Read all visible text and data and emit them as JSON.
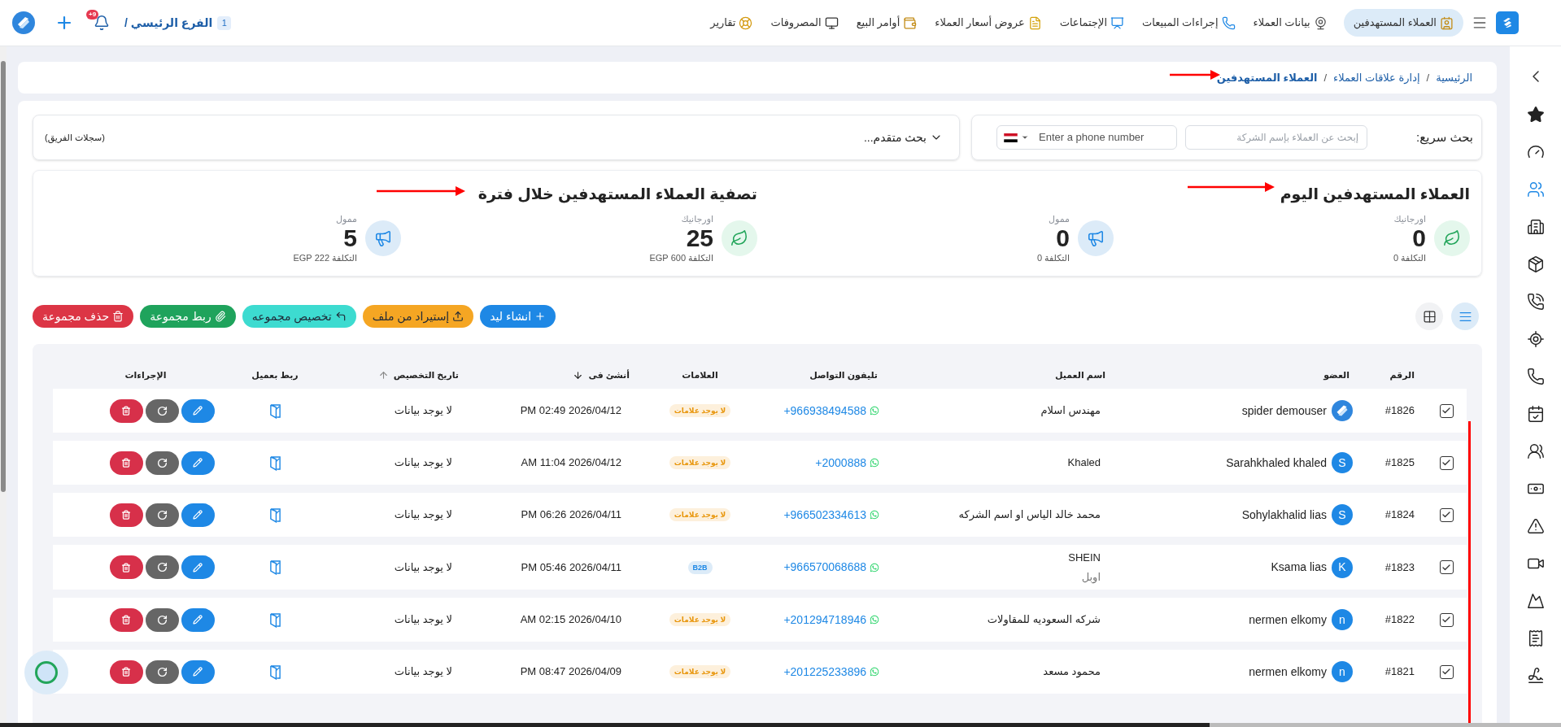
{
  "topbar": {
    "tabs": [
      {
        "label": "العملاء المستهدفين",
        "selected": true
      },
      {
        "label": "بيانات العملاء",
        "selected": false
      },
      {
        "label": "إجراءات المبيعات",
        "selected": false
      },
      {
        "label": "الإجتماعات",
        "selected": false
      },
      {
        "label": "عروض أسعار العملاء",
        "selected": false
      },
      {
        "label": "أوامر البيع",
        "selected": false
      },
      {
        "label": "المصروفات",
        "selected": false
      },
      {
        "label": "تقارير",
        "selected": false
      }
    ],
    "branch": {
      "badge": "1",
      "label": "الفرع الرئيسي /"
    },
    "notifications": {
      "badge": "+9"
    }
  },
  "sidebar": {
    "items": [
      {
        "selected": false
      },
      {
        "selected": false
      },
      {
        "selected": true
      },
      {
        "selected": false
      },
      {
        "selected": false
      },
      {
        "selected": false
      },
      {
        "selected": false
      },
      {
        "selected": false
      },
      {
        "selected": false
      },
      {
        "selected": false
      },
      {
        "selected": false
      },
      {
        "selected": false
      },
      {
        "selected": false
      },
      {
        "selected": false
      },
      {
        "selected": false
      },
      {
        "selected": false
      }
    ]
  },
  "breadcrumb": {
    "separator": "/",
    "items": [
      {
        "label": "الرئيسية",
        "current": false
      },
      {
        "label": "إدارة علاقات العملاء",
        "current": false
      },
      {
        "label": "العملاء المستهدفين",
        "current": true
      }
    ]
  },
  "quick_search": {
    "label": "بحث سريع:",
    "company_placeholder": "إبحث عن العملاء بإسم الشركة",
    "phone_placeholder": "Enter a phone number"
  },
  "advanced_search": {
    "label": "بحث متقدم...",
    "expanded": false
  },
  "team_records": "(سجلات الفريق)",
  "stats": [
    {
      "title": "العملاء المستهدفين اليوم",
      "items": [
        {
          "kind": "organic",
          "label": "اورجانيك",
          "value": "0",
          "cost": "التكلفة 0"
        },
        {
          "kind": "paid",
          "label": "ممول",
          "value": "0",
          "cost": "التكلفة 0"
        }
      ]
    },
    {
      "title": "تصفية العملاء المستهدفين خلال فترة",
      "items": [
        {
          "kind": "organic",
          "label": "اورجانيك",
          "value": "25",
          "cost": "التكلفة 600 EGP"
        },
        {
          "kind": "paid",
          "label": "ممول",
          "value": "5",
          "cost": "التكلفة 222 EGP"
        }
      ]
    }
  ],
  "view_toggle": [
    {
      "kind": "list",
      "selected": true
    },
    {
      "kind": "grid",
      "selected": false
    }
  ],
  "actions": [
    {
      "kind": "create",
      "label": "انشاء ليد"
    },
    {
      "kind": "import",
      "label": "إستيراد من ملف"
    },
    {
      "kind": "assign",
      "label": "تخصيص مجموعه"
    },
    {
      "kind": "link",
      "label": "ربط مجموعة"
    },
    {
      "kind": "delete",
      "label": "حذف مجموعة"
    }
  ],
  "table": {
    "columns": [
      {
        "label": "الرقم",
        "kind": "plain"
      },
      {
        "label": "العضو",
        "kind": "plain"
      },
      {
        "label": "اسم العميل",
        "kind": "plain"
      },
      {
        "label": "تليفون التواصل",
        "kind": "plain"
      },
      {
        "label": "العلامات",
        "kind": "plain"
      },
      {
        "label": "أنشئ فى",
        "kind": "sort_desc"
      },
      {
        "label": "تاريخ التخصيص",
        "kind": "sort_asc"
      },
      {
        "label": "ربط بعميل",
        "kind": "plain"
      },
      {
        "label": "الإجراءات",
        "kind": "plain"
      }
    ],
    "rows": [
      {
        "checked": true,
        "id": "#1826",
        "member": {
          "kind": "logo",
          "name": "spider demouser"
        },
        "client": {
          "name": "مهندس اسلام"
        },
        "phone": "+966938494588",
        "tag": {
          "kind": "none",
          "text": "لا يوجد علامات"
        },
        "created": "2026/04/12 02:49 PM",
        "assigned": "لا يوجد بيانات"
      },
      {
        "checked": true,
        "id": "#1825",
        "member": {
          "kind": "letter",
          "initial": "S",
          "name": "Sarahkhaled khaled"
        },
        "client": {
          "name": "Khaled"
        },
        "phone": "+2000888",
        "tag": {
          "kind": "none",
          "text": "لا يوجد علامات"
        },
        "created": "2026/04/12 11:04 AM",
        "assigned": "لا يوجد بيانات"
      },
      {
        "checked": true,
        "id": "#1824",
        "member": {
          "kind": "letter",
          "initial": "S",
          "name": "Sohylakhalid lias"
        },
        "client": {
          "name": "محمد خالد الياس او اسم الشركه"
        },
        "phone": "+966502334613",
        "tag": {
          "kind": "none",
          "text": "لا يوجد علامات"
        },
        "created": "2026/04/11 06:26 PM",
        "assigned": "لا يوجد بيانات"
      },
      {
        "checked": true,
        "id": "#1823",
        "member": {
          "kind": "letter",
          "initial": "K",
          "name": "Ksama lias"
        },
        "client": {
          "name": "SHEIN",
          "subtitle": "اوبل"
        },
        "phone": "+966570068688",
        "tag": {
          "kind": "label",
          "text": "B2B"
        },
        "created": "2026/04/11 05:46 PM",
        "assigned": "لا يوجد بيانات"
      },
      {
        "checked": true,
        "id": "#1822",
        "member": {
          "kind": "letter",
          "initial": "n",
          "name": "nermen elkomy"
        },
        "client": {
          "name": "شركه السعوديه للمقاولات"
        },
        "phone": "+201294718946",
        "tag": {
          "kind": "none",
          "text": "لا يوجد علامات"
        },
        "created": "2026/04/10 02:15 AM",
        "assigned": "لا يوجد بيانات"
      },
      {
        "checked": true,
        "id": "#1821",
        "member": {
          "kind": "letter",
          "initial": "n",
          "name": "nermen elkomy"
        },
        "client": {
          "name": "محمود مسعد"
        },
        "phone": "+201225233896",
        "tag": {
          "kind": "none",
          "text": "لا يوجد علامات"
        },
        "created": "2026/04/09 08:47 PM",
        "assigned": "لا يوجد بيانات"
      }
    ]
  }
}
